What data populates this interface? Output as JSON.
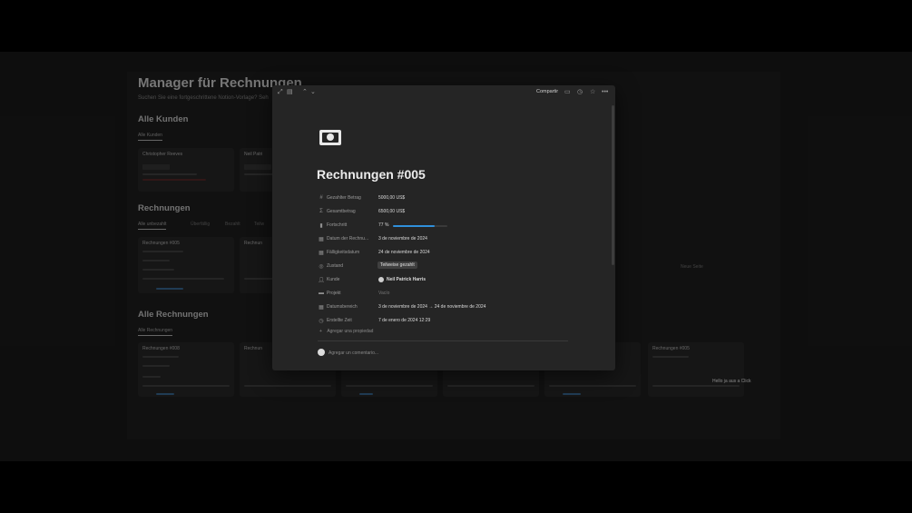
{
  "background": {
    "title": "Manager für Rechnungen",
    "subtitle": "Suchen Sie eine fortgeschrittene Notion-Vorlage? Seh",
    "customers_heading": "Alle Kunden",
    "customers_tab": "Alle Kunden",
    "invoices_heading": "Rechnungen",
    "invoices_tabs": [
      "Alle unbezahlt",
      "Überfällig",
      "Bezahlt",
      "Teilw"
    ],
    "all_invoices_heading": "Alle Rechnungen",
    "all_invoices_tab": "Alle Rechnungen",
    "customer_cards": [
      "Christopher Reeves",
      "Neil Patri"
    ],
    "invoice_cards_row1": [
      "Rechnungen #005",
      "Rechnun"
    ],
    "invoice_cards_row2": [
      "Rechnungen #008",
      "Rechnun"
    ],
    "right_card": "Rechnungen #005",
    "right_note": "Neue Seite",
    "hint": "Hello ja aus a Click"
  },
  "topbar": {
    "share_label": "Compartir"
  },
  "page": {
    "title": "Rechnungen #005",
    "properties": {
      "paid_amount": {
        "name": "Gezahlter Betrag",
        "value": "5000,00 US$"
      },
      "total_amount": {
        "name": "Gesamtbetrag",
        "value": "6500,00 US$"
      },
      "progress": {
        "name": "Fortschritt",
        "value": "77 %",
        "fraction": 0.77
      },
      "invoice_date": {
        "name": "Datum der Rechnu...",
        "value": "3 de noviembre de 2024"
      },
      "due_date": {
        "name": "Fälligkeitsdatum",
        "value": "24 de noviembre de 2024"
      },
      "status": {
        "name": "Zustand",
        "value": "Teilweise gezahlt"
      },
      "customer": {
        "name": "Kunde",
        "value": "Neil Patrick Harris"
      },
      "project": {
        "name": "Projekt",
        "value": "Vacío"
      },
      "date_range": {
        "name": "Datumsbereich",
        "value": "3 de noviembre de 2024 → 24 de noviembre de 2024"
      },
      "created": {
        "name": "Erstellte Zeit",
        "value": "7 de enero de 2024 12:29"
      }
    },
    "add_property": "Agregar una propiedad",
    "comment_placeholder": "Agregar un comentario..."
  },
  "colors": {
    "progress_fill": "#2f8fdb",
    "modal_bg": "#252525"
  }
}
